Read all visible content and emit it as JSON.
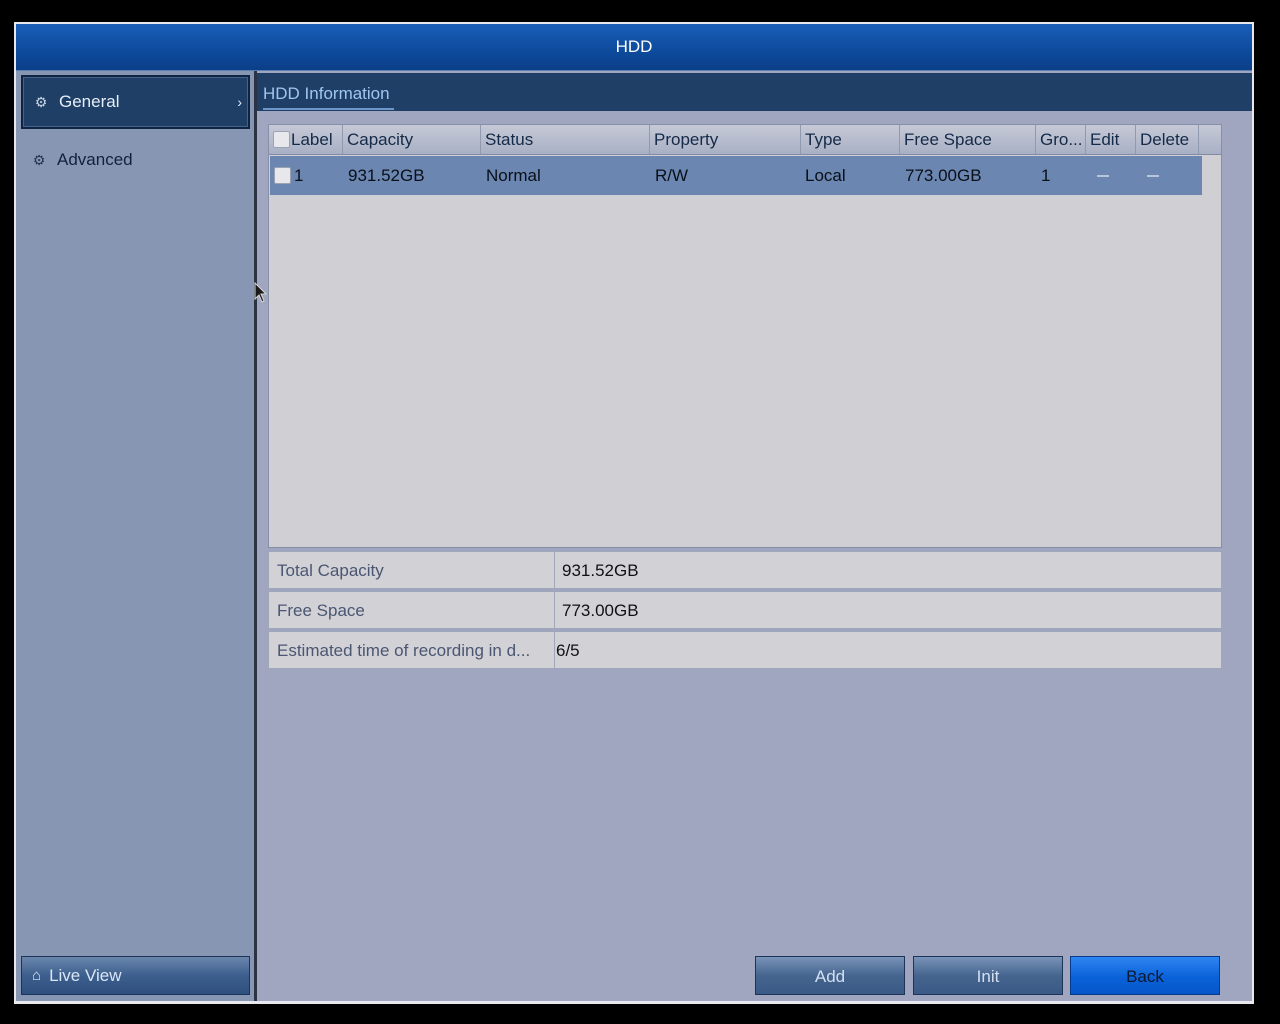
{
  "window": {
    "title": "HDD"
  },
  "sidebar": {
    "items": [
      {
        "label": "General",
        "icon": "gear-icon",
        "active": true
      },
      {
        "label": "Advanced",
        "icon": "gear-advanced-icon",
        "active": false
      }
    ],
    "live_view": {
      "label": "Live View",
      "icon": "home-icon"
    }
  },
  "tab": {
    "label": "HDD Information"
  },
  "table": {
    "columns": [
      "Label",
      "Capacity",
      "Status",
      "Property",
      "Type",
      "Free Space",
      "Gro...",
      "Edit",
      "Delete"
    ],
    "rows": [
      {
        "label": "1",
        "capacity": "931.52GB",
        "status": "Normal",
        "property": "R/W",
        "type": "Local",
        "free_space": "773.00GB",
        "group": "1"
      }
    ]
  },
  "summary": {
    "total_capacity_label": "Total Capacity",
    "total_capacity_value": "931.52GB",
    "free_space_label": "Free Space",
    "free_space_value": "773.00GB",
    "est_time_label": "Estimated time of recording in d...",
    "est_time_value": "6/5"
  },
  "buttons": {
    "add": "Add",
    "init": "Init",
    "back": "Back"
  },
  "colors": {
    "title_bar": "#0d4a9c",
    "selected_row": "#6b87b1",
    "primary_button": "#0a62d8"
  }
}
